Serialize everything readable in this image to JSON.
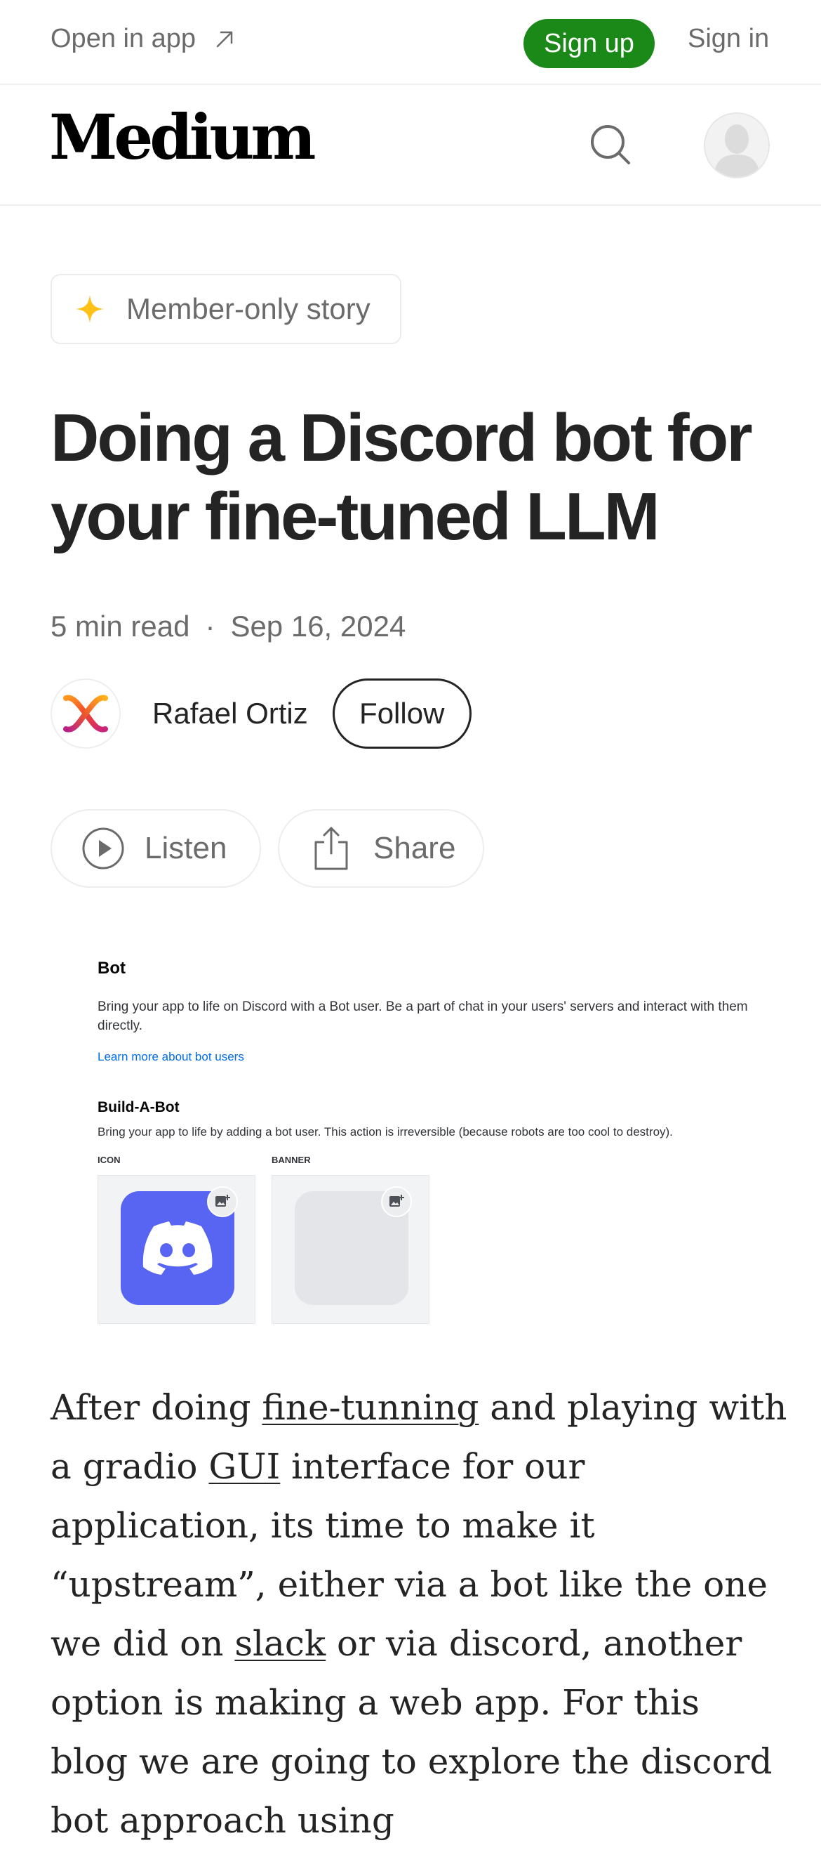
{
  "app_bar": {
    "open_in_app": "Open in app",
    "sign_up": "Sign up",
    "sign_in": "Sign in"
  },
  "header": {
    "logo": "Medium"
  },
  "article": {
    "badge": "Member-only story",
    "title": "Doing a Discord bot for your fine-tuned LLM",
    "read_time": "5 min read",
    "separator": "·",
    "date": "Sep 16, 2024",
    "author": "Rafael Ortiz",
    "follow": "Follow",
    "listen": "Listen",
    "share": "Share",
    "body": {
      "t1": "After doing ",
      "link1": "fine-tunning",
      "t2": " and playing with a gradio ",
      "link2": "GUI",
      "t3": " interface for our application, its time to make it “upstream”, either via a bot like the one we did on ",
      "link3": "slack",
      "t4": " or via discord, another option is making a web app. For this blog we are going to explore the discord bot approach using"
    }
  },
  "figure": {
    "heading": "Bot",
    "description": "Bring your app to life on Discord with a Bot user. Be a part of chat in your users' servers and interact with them directly.",
    "link": "Learn more about bot users",
    "subheading": "Build-A-Bot",
    "subdescription": "Bring your app to life by adding a bot user. This action is irreversible (because robots are too cool to destroy).",
    "icon_caption": "ICON",
    "banner_caption": "BANNER",
    "discord_color": "#5865f2"
  },
  "colors": {
    "signup_green": "#1a8917",
    "star_gold": "#ffc017"
  }
}
